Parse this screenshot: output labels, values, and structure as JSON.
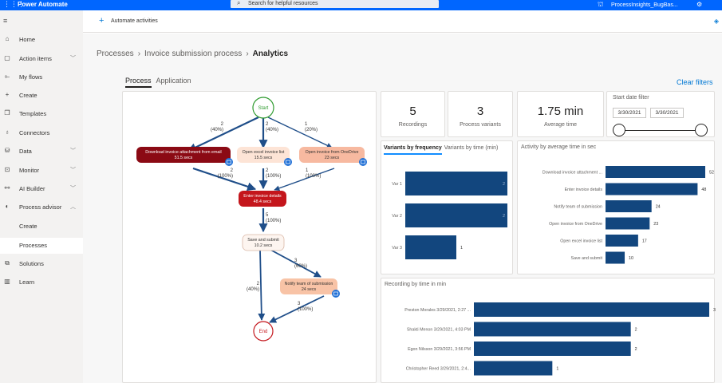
{
  "app": {
    "name": "Power Automate",
    "search_placeholder": "Search for helpful resources",
    "environment": "ProcessInsights_BugBas..."
  },
  "sidebar": {
    "items": [
      {
        "label": "Home",
        "icon": "home-icon",
        "glyph": "⌂"
      },
      {
        "label": "Action items",
        "icon": "clipboard-icon",
        "glyph": "▢",
        "chevron": true
      },
      {
        "label": "My flows",
        "icon": "flow-icon",
        "glyph": "⟜"
      },
      {
        "label": "Create",
        "icon": "plus-icon",
        "glyph": "+"
      },
      {
        "label": "Templates",
        "icon": "templates-icon",
        "glyph": "❐"
      },
      {
        "label": "Connectors",
        "icon": "connector-icon",
        "glyph": "♁"
      },
      {
        "label": "Data",
        "icon": "database-icon",
        "glyph": "⛁",
        "chevron": true
      },
      {
        "label": "Monitor",
        "icon": "monitor-icon",
        "glyph": "⊡",
        "chevron": true
      },
      {
        "label": "AI Builder",
        "icon": "ai-builder-icon",
        "glyph": "⚯",
        "chevron": true
      },
      {
        "label": "Process advisor",
        "icon": "process-advisor-icon",
        "glyph": "◐",
        "chevron": true,
        "expanded": true
      },
      {
        "label": "Create",
        "sub": true
      },
      {
        "label": "Processes",
        "sub": true,
        "active": true
      },
      {
        "label": "Solutions",
        "icon": "solutions-icon",
        "glyph": "⧉"
      },
      {
        "label": "Learn",
        "icon": "book-icon",
        "glyph": "▥"
      }
    ]
  },
  "commandbar": {
    "automate_label": "Automate activities"
  },
  "breadcrumb": {
    "root": "Processes",
    "process": "Invoice submission process",
    "current": "Analytics"
  },
  "tabs": {
    "process": "Process",
    "application": "Application"
  },
  "clear_filters": "Clear filters",
  "kpis": [
    {
      "value": "5",
      "label": "Recordings"
    },
    {
      "value": "3",
      "label": "Process variants"
    },
    {
      "value": "1.75 min",
      "label": "Average time"
    }
  ],
  "date_filter": {
    "title": "Start date filter",
    "from": "3/30/2021",
    "to": "3/30/2021"
  },
  "process_map": {
    "start_label": "Start",
    "end_label": "End",
    "nodes": [
      {
        "title": "Download invoice attachment from email",
        "time": "51.5 secs",
        "color": "#8b0a14",
        "text_color": "#ffffff"
      },
      {
        "title": "Open excel invoice list",
        "time": "15.5 secs",
        "color": "#fde4d6",
        "text_color": "#323130"
      },
      {
        "title": "Open invoice from OneDrive",
        "time": "23 secs",
        "color": "#f7b9a0",
        "text_color": "#323130"
      },
      {
        "title": "Enter invoice details",
        "time": "48.4 secs",
        "color": "#c4161c",
        "text_color": "#ffffff"
      },
      {
        "title": "Save and submit",
        "time": "10.2 secs",
        "color": "#fdf5f0",
        "text_color": "#323130"
      },
      {
        "title": "Notify team of submission",
        "time": "24 secs",
        "color": "#f8c3a6",
        "text_color": "#323130"
      }
    ],
    "edges": [
      {
        "count": "2",
        "pct": "(40%)"
      },
      {
        "count": "2",
        "pct": "(40%)"
      },
      {
        "count": "1",
        "pct": "(20%)"
      },
      {
        "count": "2",
        "pct": "(100%)"
      },
      {
        "count": "2",
        "pct": "(100%)"
      },
      {
        "count": "1",
        "pct": "(100%)"
      },
      {
        "count": "5",
        "pct": "(100%)"
      },
      {
        "count": "3",
        "pct": "(60%)"
      },
      {
        "count": "2",
        "pct": "(40%)"
      },
      {
        "count": "3",
        "pct": "(100%)"
      }
    ]
  },
  "variants": {
    "tab_frequency": "Variants by frequency",
    "tab_time": "Variants by time (min)"
  },
  "bar_color": "#12467e",
  "chart_data": [
    {
      "type": "bar",
      "orientation": "horizontal",
      "categories": [
        "Var 1",
        "Var 2",
        "Var 3"
      ],
      "values": [
        2,
        2,
        1
      ],
      "labels": [
        "2",
        "2",
        "1"
      ],
      "xlim": [
        0,
        2
      ]
    },
    {
      "type": "bar",
      "orientation": "horizontal",
      "title": "Activity by average time in sec",
      "categories": [
        "Download invoice attachment ...",
        "Enter invoice details",
        "Notify team of submission",
        "Open invoice from OneDrive",
        "Open excel invoice list",
        "Save and submit"
      ],
      "values": [
        52,
        48,
        24,
        23,
        17,
        10
      ],
      "labels": [
        "52",
        "48",
        "24",
        "23",
        "17",
        "10"
      ],
      "xlim": [
        0,
        52
      ]
    },
    {
      "type": "bar",
      "orientation": "horizontal",
      "title": "Recording by time in min",
      "categories": [
        "Preston Morales 3/29/2021, 2:27 ...",
        "Shakti Menon 3/29/2021, 4:03 PM",
        "Egon Nilsson 3/29/2021, 3:56 PM",
        "Christopher Reed 3/29/2021, 2:4..."
      ],
      "values": [
        3,
        2,
        2,
        1
      ],
      "labels": [
        "3",
        "2",
        "2",
        "1"
      ],
      "xlim": [
        0,
        3
      ]
    }
  ]
}
